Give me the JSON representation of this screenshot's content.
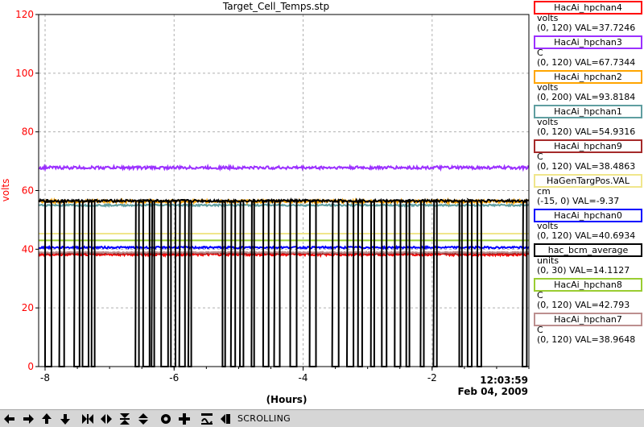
{
  "title": "Target_Cell_Temps.stp",
  "chart_data": {
    "type": "line",
    "title": "Target_Cell_Temps.stp",
    "xlabel": "(Hours)",
    "ylabel": "volts",
    "xlim": [
      -8.1,
      -0.5
    ],
    "ylim": [
      0,
      120
    ],
    "x_ticks": [
      "-8",
      "-6",
      "-4",
      "-2"
    ],
    "x_tick_values": [
      -8,
      -6,
      -4,
      -2
    ],
    "y_ticks": [
      "0",
      "20",
      "40",
      "60",
      "80",
      "100",
      "120"
    ],
    "y_tick_values": [
      0,
      20,
      40,
      60,
      80,
      100,
      120
    ],
    "grid": true,
    "time_label": "12:03:59",
    "date_label": "Feb 04, 2009",
    "series": [
      {
        "name": "HacAi_hpchan4",
        "color": "#ff0000",
        "level": 38.2,
        "noise": 0.4
      },
      {
        "name": "HacAi_hpchan3",
        "color": "#9b30ff",
        "level": 67.8,
        "noise": 0.5
      },
      {
        "name": "HacAi_hpchan2",
        "color": "#ffa500",
        "level": 56.3,
        "noise": 0.5
      },
      {
        "name": "HacAi_hpchan1",
        "color": "#5f9ea0",
        "level": 55.0,
        "noise": 0.3
      },
      {
        "name": "HacAi_hpchan9",
        "color": "#a52a2a",
        "level": 38.6,
        "noise": 0.3
      },
      {
        "name": "HaGenTargPos.VAL",
        "color": "#f0e68c",
        "level": 45.3,
        "noise": 0.0
      },
      {
        "name": "HacAi_hpchan0",
        "color": "#0000ff",
        "level": 40.6,
        "noise": 0.3
      },
      {
        "name": "hac_bcm_average",
        "color": "#000000",
        "level": 56.5,
        "noise": 0.4,
        "dropouts": true
      },
      {
        "name": "HacAi_hpchan8",
        "color": "#9acd32",
        "level": 43.0,
        "noise": 0.0
      },
      {
        "name": "HacAi_hpchan7",
        "color": "#bc8f8f",
        "level": 38.9,
        "noise": 0.2
      }
    ]
  },
  "legend": [
    {
      "name": "HacAi_hpchan4",
      "color": "#ff0000",
      "unit": "volts",
      "range": "(0, 120) VAL=37.7246"
    },
    {
      "name": "HacAi_hpchan3",
      "color": "#9b30ff",
      "unit": "C",
      "range": "(0, 120) VAL=67.7344"
    },
    {
      "name": "HacAi_hpchan2",
      "color": "#ffa500",
      "unit": "volts",
      "range": "(0, 200) VAL=93.8184"
    },
    {
      "name": "HacAi_hpchan1",
      "color": "#5f9ea0",
      "unit": "volts",
      "range": "(0, 120) VAL=54.9316"
    },
    {
      "name": "HacAi_hpchan9",
      "color": "#a52a2a",
      "unit": "C",
      "range": "(0, 120) VAL=38.4863"
    },
    {
      "name": "HaGenTargPos.VAL",
      "color": "#f0e68c",
      "unit": "cm",
      "range": "(-15, 0) VAL=-9.37"
    },
    {
      "name": "HacAi_hpchan0",
      "color": "#0000ff",
      "unit": "volts",
      "range": "(0, 120) VAL=40.6934"
    },
    {
      "name": "hac_bcm_average",
      "color": "#000000",
      "unit": "units",
      "range": "(0, 30) VAL=14.1127"
    },
    {
      "name": "HacAi_hpchan8",
      "color": "#9acd32",
      "unit": "C",
      "range": "(0, 120) VAL=42.793"
    },
    {
      "name": "HacAi_hpchan7",
      "color": "#bc8f8f",
      "unit": "C",
      "range": "(0, 120) VAL=38.9648"
    }
  ],
  "toolbar": {
    "status": "SCROLLING",
    "buttons": [
      "arrow-left-icon",
      "arrow-right-icon",
      "arrow-up-icon",
      "arrow-down-icon",
      "expand-horizontal-icon",
      "compress-horizontal-icon",
      "expand-vertical-icon",
      "compress-vertical-icon",
      "snapshot-icon",
      "crosshair-icon",
      "autoscale-icon",
      "scroll-mode-icon"
    ]
  }
}
